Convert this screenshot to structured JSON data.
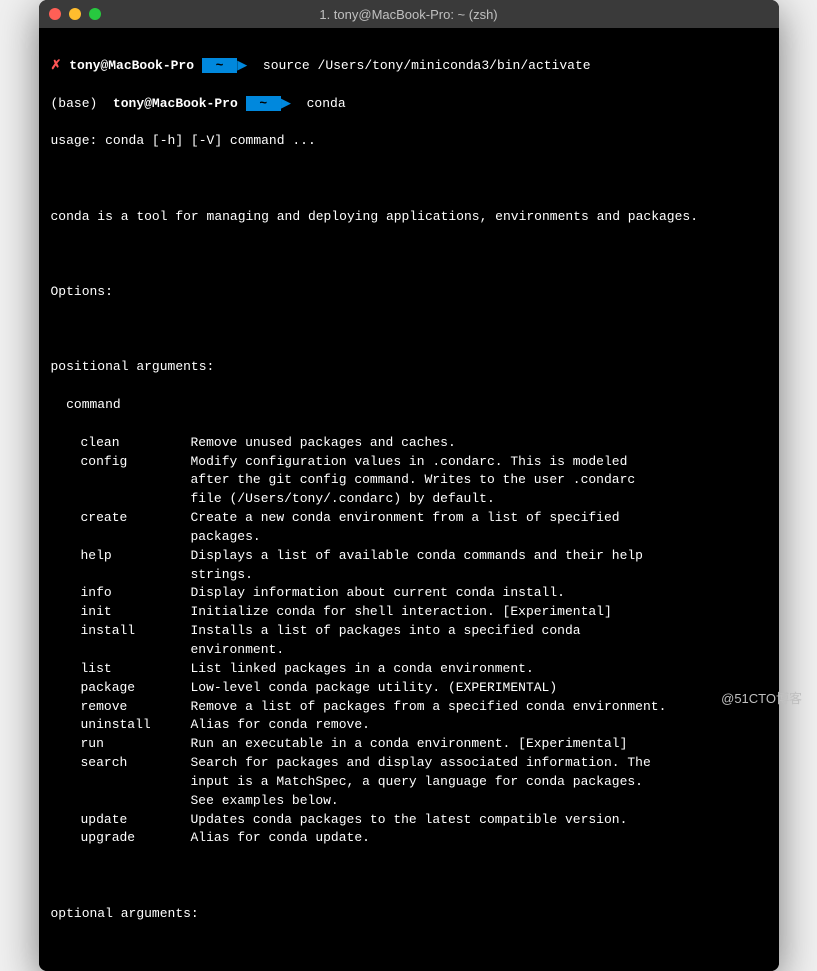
{
  "window": {
    "title": "1. tony@MacBook-Pro: ~ (zsh)"
  },
  "prompts": [
    {
      "marker": "✗",
      "host": "tony@MacBook-Pro",
      "dir": "~",
      "command": "source /Users/tony/miniconda3/bin/activate"
    },
    {
      "prefix": "(base) ",
      "host": "tony@MacBook-Pro",
      "dir": "~",
      "command": "conda"
    }
  ],
  "usage": "usage: conda [-h] [-V] command ...",
  "description": "conda is a tool for managing and deploying applications, environments and packages.",
  "sections": {
    "options": "Options:",
    "positional": "positional arguments:",
    "command_label": "  command",
    "optional": "optional arguments:"
  },
  "commands": [
    {
      "name": "clean",
      "desc": [
        "Remove unused packages and caches."
      ]
    },
    {
      "name": "config",
      "desc": [
        "Modify configuration values in .condarc. This is modeled",
        "after the git config command. Writes to the user .condarc",
        "file (/Users/tony/.condarc) by default."
      ]
    },
    {
      "name": "create",
      "desc": [
        "Create a new conda environment from a list of specified",
        "packages."
      ]
    },
    {
      "name": "help",
      "desc": [
        "Displays a list of available conda commands and their help",
        "strings."
      ]
    },
    {
      "name": "info",
      "desc": [
        "Display information about current conda install."
      ]
    },
    {
      "name": "init",
      "desc": [
        "Initialize conda for shell interaction. [Experimental]"
      ]
    },
    {
      "name": "install",
      "desc": [
        "Installs a list of packages into a specified conda",
        "environment."
      ]
    },
    {
      "name": "list",
      "desc": [
        "List linked packages in a conda environment."
      ]
    },
    {
      "name": "package",
      "desc": [
        "Low-level conda package utility. (EXPERIMENTAL)"
      ]
    },
    {
      "name": "remove",
      "desc": [
        "Remove a list of packages from a specified conda environment."
      ]
    },
    {
      "name": "uninstall",
      "desc": [
        "Alias for conda remove."
      ]
    },
    {
      "name": "run",
      "desc": [
        "Run an executable in a conda environment. [Experimental]"
      ]
    },
    {
      "name": "search",
      "desc": [
        "Search for packages and display associated information. The",
        "input is a MatchSpec, a query language for conda packages.",
        "See examples below."
      ]
    },
    {
      "name": "update",
      "desc": [
        "Updates conda packages to the latest compatible version."
      ]
    },
    {
      "name": "upgrade",
      "desc": [
        "Alias for conda update."
      ]
    }
  ],
  "watermark": "@51CTO博客"
}
